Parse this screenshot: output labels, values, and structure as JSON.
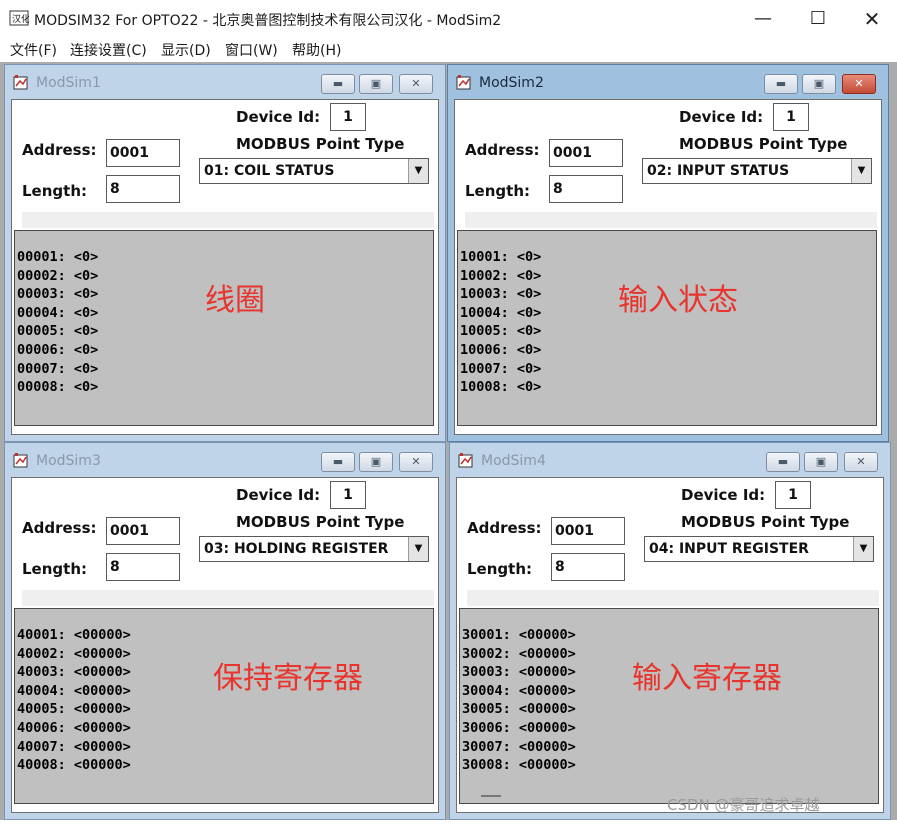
{
  "window": {
    "title": "MODSIM32 For OPTO22 - 北京奥普图控制技术有限公司汉化 - ModSim2",
    "controls": {
      "minimize": "—",
      "maximize": "☐",
      "close": "✕"
    }
  },
  "menu": [
    {
      "label": "文件(F)"
    },
    {
      "label": "连接设置(C)"
    },
    {
      "label": "显示(D)"
    },
    {
      "label": "窗口(W)"
    },
    {
      "label": "帮助(H)"
    }
  ],
  "labels": {
    "device_id": "Device Id:",
    "point_type": "MODBUS Point Type",
    "address": "Address:",
    "length": "Length:"
  },
  "children": [
    {
      "name": "ModSim1",
      "active": false,
      "device_id": "1",
      "address": "0001",
      "length": "8",
      "point_type": "01: COIL STATUS",
      "annotation": "线圈",
      "registers": [
        "00001: <0>",
        "00002: <0>",
        "00003: <0>",
        "00004: <0>",
        "00005: <0>",
        "00006: <0>",
        "00007: <0>",
        "00008: <0>"
      ]
    },
    {
      "name": "ModSim2",
      "active": true,
      "device_id": "1",
      "address": "0001",
      "length": "8",
      "point_type": "02: INPUT STATUS",
      "annotation": "输入状态",
      "registers": [
        "10001: <0>",
        "10002: <0>",
        "10003: <0>",
        "10004: <0>",
        "10005: <0>",
        "10006: <0>",
        "10007: <0>",
        "10008: <0>"
      ]
    },
    {
      "name": "ModSim3",
      "active": false,
      "device_id": "1",
      "address": "0001",
      "length": "8",
      "point_type": "03: HOLDING REGISTER",
      "annotation": "保持寄存器",
      "registers": [
        "40001: <00000>",
        "40002: <00000>",
        "40003: <00000>",
        "40004: <00000>",
        "40005: <00000>",
        "40006: <00000>",
        "40007: <00000>",
        "40008: <00000>"
      ]
    },
    {
      "name": "ModSim4",
      "active": false,
      "device_id": "1",
      "address": "0001",
      "length": "8",
      "point_type": "04: INPUT REGISTER",
      "annotation": "输入寄存器",
      "registers": [
        "30001: <00000>",
        "30002: <00000>",
        "30003: <00000>",
        "30004: <00000>",
        "30005: <00000>",
        "30006: <00000>",
        "30007: <00000>",
        "30008: <00000>"
      ]
    }
  ],
  "watermark": "CSDN @豪哥追求卓越",
  "colors": {
    "annotation": "#e8342c",
    "data_bg": "#c0c0c0",
    "active_title": "#9fc0df"
  }
}
